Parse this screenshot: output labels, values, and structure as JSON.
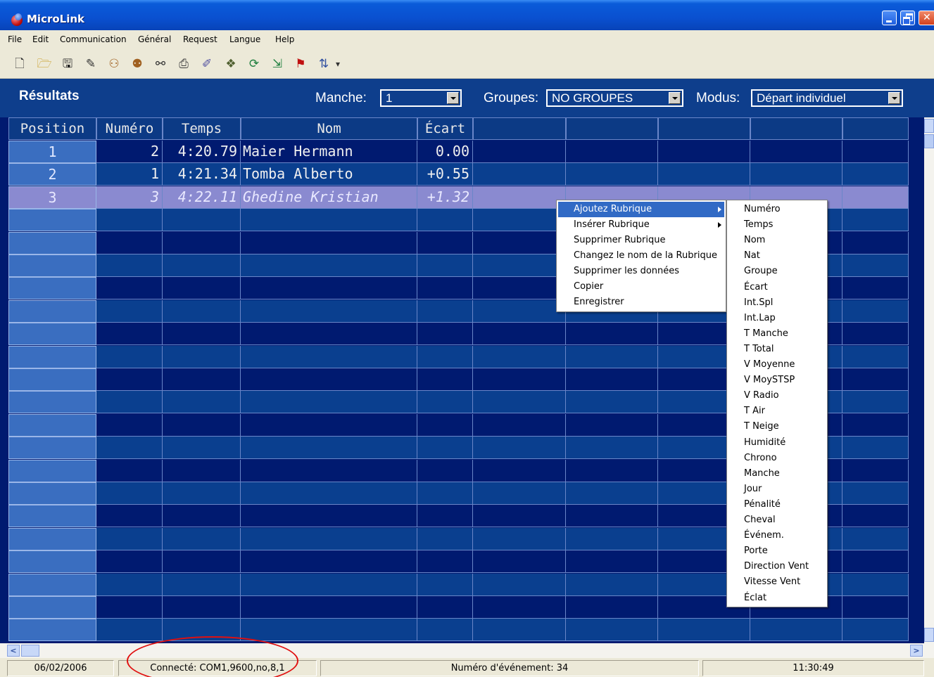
{
  "window": {
    "title": "MicroLink"
  },
  "menubar": [
    "File",
    "Edit",
    "Communication",
    "Général",
    "Request",
    "Langue",
    "Help"
  ],
  "toolbar_icons": [
    "new-file-icon",
    "open-folder-icon",
    "save-disk-icon",
    "wand-icon",
    "people-icon",
    "people-search-icon",
    "binoculars-icon",
    "print-preview-icon",
    "edit-pencil-icon",
    "group-icon",
    "refresh-icon",
    "export-icon",
    "flag-icon",
    "sort-icon",
    "dropdown-arrow-icon"
  ],
  "header": {
    "title": "Résultats",
    "manche_label": "Manche:",
    "manche_value": "1",
    "groupes_label": "Groupes:",
    "groupes_value": "NO GROUPES",
    "modus_label": "Modus:",
    "modus_value": "Départ individuel"
  },
  "grid": {
    "columns": [
      "Position",
      "Numéro",
      "Temps",
      "Nom",
      "Écart",
      "",
      "",
      "",
      "",
      ""
    ],
    "rows": [
      {
        "position": "1",
        "numero": "2",
        "temps": "4:20.79",
        "nom": "Maier Hermann",
        "ecart": "0.00"
      },
      {
        "position": "2",
        "numero": "1",
        "temps": "4:21.34",
        "nom": "Tomba Alberto",
        "ecart": "+0.55"
      },
      {
        "position": "3",
        "numero": "3",
        "temps": "4:22.11",
        "nom": "Ghedine Kristian",
        "ecart": "+1.32"
      }
    ],
    "selected_row": 2,
    "empty_rows": 19
  },
  "context_menu": {
    "items": [
      {
        "label": "Ajoutez Rubrique",
        "submenu": true,
        "highlighted": true
      },
      {
        "label": "Insérer Rubrique",
        "submenu": true
      },
      {
        "label": "Supprimer Rubrique"
      },
      {
        "label": "Changez le nom de la Rubrique"
      },
      {
        "label": "Supprimer les données"
      },
      {
        "label": "Copier"
      },
      {
        "label": "Enregistrer"
      }
    ],
    "submenu": [
      "Numéro",
      "Temps",
      "Nom",
      "Nat",
      "Groupe",
      "Écart",
      "Int.Spl",
      "Int.Lap",
      "T Manche",
      "T Total",
      "V Moyenne",
      "V MoySTSP",
      "V Radio",
      "T Air",
      "T Neige",
      "Humidité",
      "Chrono",
      "Manche",
      "Jour",
      "Pénalité",
      "Cheval",
      "Événem.",
      "Porte",
      "Direction Vent",
      "Vitesse Vent",
      "Éclat"
    ]
  },
  "statusbar": {
    "date": "06/02/2006",
    "connection": "Connecté: COM1,9600,no,8,1",
    "event": "Numéro d'événement: 34",
    "time": "11:30:49"
  }
}
